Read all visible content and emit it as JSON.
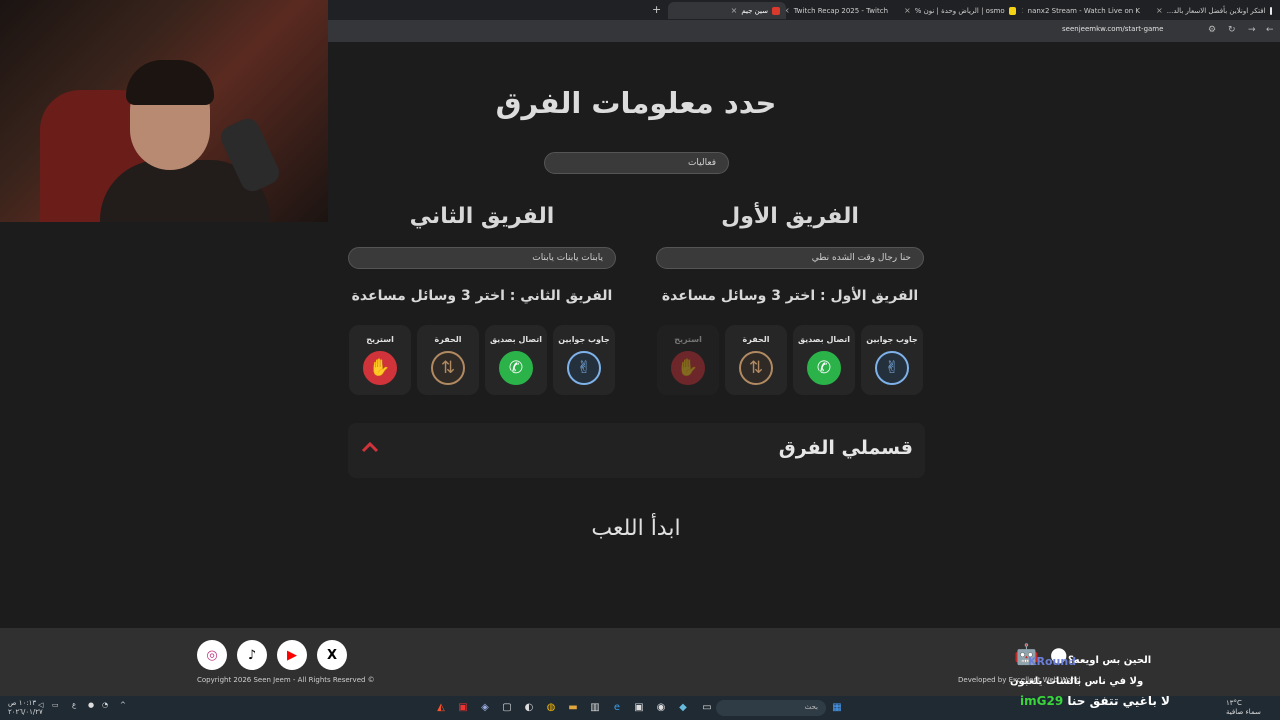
{
  "browser": {
    "tabs": [
      {
        "label": "افتكر اونلاين بأفضل الاسعار بالد...",
        "fav": "#e8e8e8"
      },
      {
        "label": "nanx2 Stream - Watch Live on K",
        "fav": "#53fc18"
      },
      {
        "label": "osmo | الرياض وحدة | نون %",
        "fav": "#f5d312"
      },
      {
        "label": "Twitch Recap 2025 - Twitch",
        "fav": "#9146ff"
      },
      {
        "label": "سين جيم",
        "fav": "#d93a2b"
      }
    ],
    "url": "seenjeemkw.com/start-game"
  },
  "page": {
    "heading": "حدد معلومات الفرق",
    "category_input": "فعاليات",
    "team1": {
      "title": "الفريق الأول",
      "name_value": "حنا رجال وقت الشده نطي",
      "instruction": "الفريق الأول : اختر 3 وسائل مساعدة"
    },
    "team2": {
      "title": "الفريق الثاني",
      "name_value": "يابنات يابنات يابنات",
      "instruction": "الفريق الثاني : اختر 3 وسائل مساعدة"
    },
    "aids": {
      "answer_two": "جاوب جوابين",
      "call_friend": "اتصال بصديق",
      "pit": "الحفرة",
      "rest": "استريح"
    },
    "accordion_title": "قسملي الفرق",
    "start_button": "ابدأ اللعب"
  },
  "footer": {
    "social": [
      "X",
      "youtube-icon",
      "tiktok-icon",
      "instagram-icon"
    ],
    "copyright": "Copyright 2026 Seen Jeem - All Rights Reserved ©",
    "developed_by": "Developed by Excellent Web World",
    "overlay_line1": "الحين بس اويعه؟",
    "overlay_line2": "ولا في ناس بالشات يلعبون",
    "overlay_tag": "KRound"
  },
  "taskbar": {
    "search_placeholder": "بحث",
    "chat_user": "imG29",
    "chat_msg": "لا باغيي تتفق حنا",
    "weather": "١٣°C",
    "weather_desc": "سماء صافية",
    "time": "١٠:١٣ ص",
    "date": "٢٠٢٦/٠١/٢٧",
    "lang": "ع"
  },
  "colors": {
    "accent_red": "#d0343a",
    "green": "#2bb34a",
    "blue": "#7fb2ea",
    "tan": "#b18a62"
  }
}
